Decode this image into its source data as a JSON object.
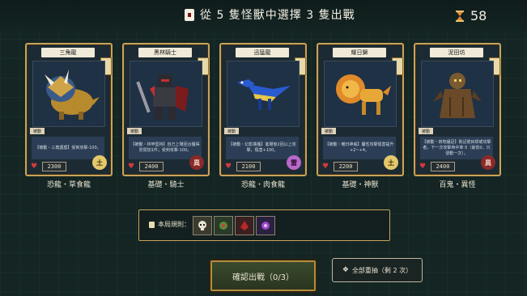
{
  "header": {
    "title": "從 5 隻怪獸中選擇 3 隻出戰",
    "title_icon": "card-icon",
    "timer_value": "58",
    "timer_icon": "hourglass-icon"
  },
  "cards": [
    {
      "name": "三角龍",
      "art_icon": "triceratops-icon",
      "tag": "被動",
      "description": "【被動・三角護盾】受到攻擊-100。",
      "hp": "2300",
      "element_glyph": "土",
      "element_color": "#e4c86a",
      "type": "恐龍・草食龍"
    },
    {
      "name": "黑林騎士",
      "art_icon": "dark-knight-icon",
      "tag": "被動",
      "description": "【被動・林甲堅持】自己上場回合獲得防禦加1件；受到攻擊-100。",
      "hp": "2400",
      "element_glyph": "異",
      "element_color": "#8a2a2a",
      "type": "基礎・騎士"
    },
    {
      "name": "迅猛龍",
      "art_icon": "velociraptor-icon",
      "tag": "被動",
      "description": "【被動・幻影擒獲】進場後2回以上攻擊，傷害+100。",
      "hp": "2100",
      "element_glyph": "雷",
      "element_color": "#b868c8",
      "type": "恐龍・肉食龍"
    },
    {
      "name": "耀日獅",
      "art_icon": "sun-lion-icon",
      "tag": "被動",
      "description": "【被動・耀日神威】屬性攻擊傷害提升+2~+4。",
      "hp": "2200",
      "element_glyph": "土",
      "element_color": "#e4c86a",
      "type": "基礎・神獸"
    },
    {
      "name": "泥田坊",
      "art_icon": "mud-ghost-icon",
      "tag": "被動",
      "description": "【被動・田地纏足】對記號目標或攻擊者，下一次攻擊命中率-5（最低0，只發動一次）。",
      "hp": "2400",
      "element_glyph": "異",
      "element_color": "#8a2a2a",
      "type": "百鬼・異怪"
    }
  ],
  "rules": {
    "label": "本局規則：",
    "icons": [
      "skull-rule-icon",
      "vine-rule-icon",
      "blood-rule-icon",
      "purple-claw-rule-icon"
    ]
  },
  "actions": {
    "confirm_label": "確認出戰（0/3）",
    "reroll_label": "全部重抽（剩 2 次）",
    "reroll_icon": "dice-icon"
  }
}
